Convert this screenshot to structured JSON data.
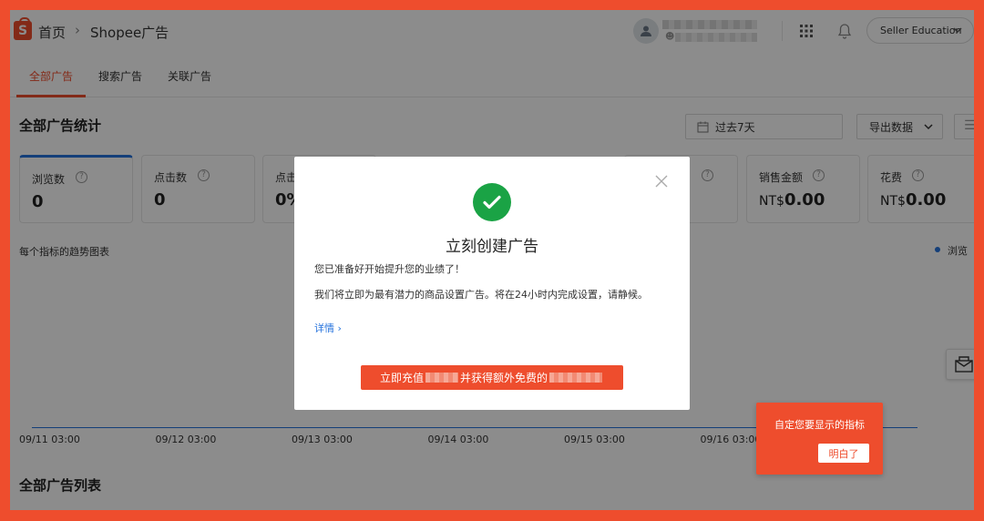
{
  "header": {
    "logo_letter": "S",
    "breadcrumb_home": "首页",
    "breadcrumb_sep": "›",
    "breadcrumb_page": "Shopee广告",
    "seller_education": "Seller Education"
  },
  "tabs": [
    {
      "label": "全部广告",
      "active": true
    },
    {
      "label": "搜索广告",
      "active": false
    },
    {
      "label": "关联广告",
      "active": false
    }
  ],
  "stats": {
    "title": "全部广告统计",
    "date_range": "过去7天",
    "export_label": "导出数据",
    "cards": [
      {
        "label": "浏览数",
        "value": "0",
        "currency": ""
      },
      {
        "label": "点击数",
        "value": "0",
        "currency": ""
      },
      {
        "label": "点击",
        "value": "0%",
        "currency": ""
      },
      {
        "label": "销售金额",
        "value": "0.00",
        "currency": "NT$"
      },
      {
        "label": "花费",
        "value": "0.00",
        "currency": "NT$"
      }
    ]
  },
  "chart_data": {
    "type": "line",
    "title": "每个指标的趋势图表",
    "legend": [
      "浏览数"
    ],
    "legend_label": "浏览",
    "x": [
      "09/11 03:00",
      "09/12 03:00",
      "09/13 03:00",
      "09/14 03:00",
      "09/15 03:00",
      "09/16 03:00"
    ],
    "series": [
      {
        "name": "浏览数",
        "values": [
          0,
          0,
          0,
          0,
          0,
          0
        ]
      }
    ],
    "xlabel": "",
    "ylabel": ""
  },
  "list_title": "全部广告列表",
  "modal": {
    "title": "立刻创建广告",
    "line1": "您已准备好开始提升您的业绩了！",
    "line2": "我们将立即为最有潜力的商品设置广告。将在24小时内完成设置，请静候。",
    "link": "详情 ›",
    "cta_part1": "立即充值",
    "cta_part2": "并获得额外免费的"
  },
  "tooltip": {
    "text": "自定您要显示的指标",
    "button": "明白了"
  },
  "colors": {
    "brand": "#ee4d2d",
    "accent_blue": "#2673dd",
    "success": "#1aa345"
  }
}
